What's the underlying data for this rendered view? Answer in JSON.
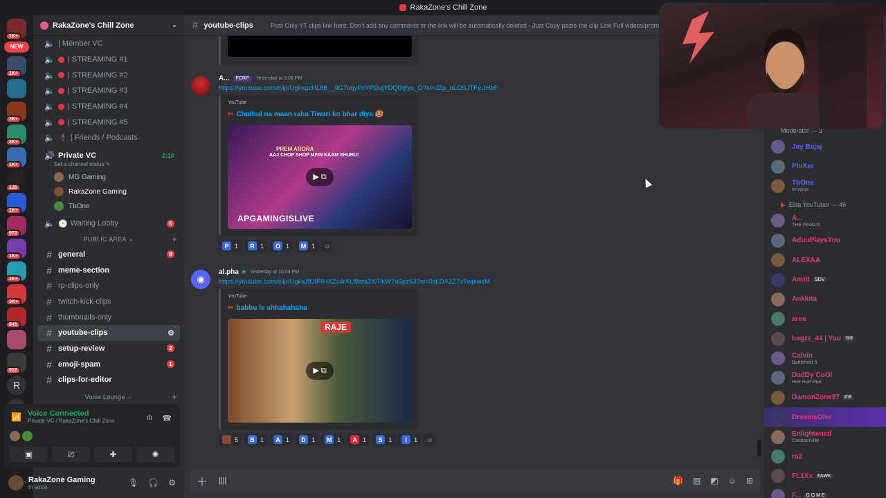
{
  "window": {
    "title": "RakaZone's Chill Zone"
  },
  "server_rail": [
    {
      "badge": "1K+"
    },
    {
      "badge": "NEW"
    },
    {
      "badge": "1K+"
    },
    {
      "badge": ""
    },
    {
      "badge": "3K+"
    },
    {
      "badge": "2K+"
    },
    {
      "badge": "1K+"
    },
    {
      "badge": "135"
    },
    {
      "badge": "1K+"
    },
    {
      "badge": "972"
    },
    {
      "badge": "1K+"
    },
    {
      "badge": "1K+"
    },
    {
      "badge": "3K+"
    },
    {
      "badge": "845"
    },
    {
      "badge": ""
    },
    {
      "badge": "512"
    }
  ],
  "server_rail_r": "R",
  "server": {
    "name": "RakaZone's Chill Zone"
  },
  "voice_channels": [
    {
      "label": "| Member VC",
      "icon": "speaker-icon"
    },
    {
      "label": "| STREAMING #1"
    },
    {
      "label": "| STREAMING #2"
    },
    {
      "label": "| STREAMING #3"
    },
    {
      "label": "| STREAMING #4"
    },
    {
      "label": "| STREAMING #5"
    },
    {
      "label": "| Friends / Podcasts"
    }
  ],
  "private_vc": {
    "label": "Private VC",
    "time": "2:10",
    "status": "Set a channel status"
  },
  "voice_users": [
    {
      "name": "MG Gaming",
      "color": "#8a6a4a"
    },
    {
      "name": "RakaZone Gaming",
      "color": "#7a5030"
    },
    {
      "name": "TbOne",
      "color": "#4a8a3a"
    }
  ],
  "waiting_lobby": {
    "label": "Waiting Lobby",
    "badge": "6"
  },
  "public_area": "PUBLIC AREA",
  "text_channels": [
    {
      "label": "general",
      "badge": "8",
      "bright": true
    },
    {
      "label": "meme-section",
      "badge": "",
      "bright": true
    },
    {
      "label": "rp-clips-only",
      "badge": "",
      "bright": false
    },
    {
      "label": "twitch-kick-clips",
      "badge": "",
      "bright": false
    },
    {
      "label": "thumbnails-only",
      "badge": "",
      "bright": false
    },
    {
      "label": "youtube-clips",
      "badge": "",
      "bright": true,
      "active": true
    },
    {
      "label": "setup-review",
      "badge": "2",
      "bright": true
    },
    {
      "label": "emoji-spam",
      "badge": "1",
      "bright": true
    },
    {
      "label": "clips-for-editor",
      "badge": "",
      "bright": true
    }
  ],
  "voice_lounge": "Voice Lounge",
  "voice_panel": {
    "title": "Voice Connected",
    "subtitle": "Private VC / RakaZone's Chill Zone"
  },
  "user": {
    "name": "RakaZone Gaming",
    "status": "In voice"
  },
  "channel": {
    "name": "youtube-clips",
    "topic": "Post Only YT clips link here. Don't add any comments or the link will be automatically deleted - Just Copy paste the clip Link Full videos/promot"
  },
  "messages": [
    {
      "author": "A...",
      "tag": "FCRP",
      "timestamp": "Yesterday at 9:06 PM",
      "link": "https://youtube.com/clip/UgkxgcHL88__9G7utjyPcYPDujYDQ0qfyo_O?si=JZp_oLOSJTFy.JHbF",
      "embed": {
        "provider": "YouTube",
        "title": "Chulbul na maan raha Tiwari ko bhar diya 🥵"
      },
      "thumb_lines": [
        "PREM ARORA",
        "AAJ CHOP SHOP MEIN KAAM SHURU!",
        "APGAMINGISLIVE"
      ],
      "reactions": [
        {
          "letter": "P",
          "count": "1"
        },
        {
          "letter": "R",
          "count": "1"
        },
        {
          "letter": "O",
          "count": "1"
        },
        {
          "letter": "M",
          "count": "1"
        }
      ]
    },
    {
      "author": "al.pha",
      "tag": "",
      "timestamp": "Yesterday at 10:44 PM",
      "link": "https://youtube.com/clip/UgkxJfU8RHXZc4rALf8sfa2I07lkW7a5pz53?si=0xLDA2Z7vTwplwcM",
      "embed": {
        "provider": "YouTube",
        "title": "babbu le ahhahahaha"
      },
      "thumb_lines": [
        "RAJE"
      ],
      "reactions": [
        {
          "letter": "",
          "count": "5",
          "img": true
        },
        {
          "letter": "B",
          "count": "1"
        },
        {
          "letter": "A",
          "count": "1"
        },
        {
          "letter": "D",
          "count": "1"
        },
        {
          "letter": "M",
          "count": "1"
        },
        {
          "letter": "A",
          "count": "1",
          "red": true
        },
        {
          "letter": "S",
          "count": "1"
        },
        {
          "letter": "I",
          "count": "1"
        }
      ]
    }
  ],
  "composer": {
    "text": "||||"
  },
  "members": {
    "moderator_group": "Moderator — 3",
    "moderators": [
      {
        "name": "Jay Bajaj",
        "color": "#5865f2",
        "activity": ""
      },
      {
        "name": "PhiXer",
        "color": "#5865f2",
        "activity": ""
      },
      {
        "name": "TbOne",
        "color": "#5865f2",
        "activity": "In voice"
      }
    ],
    "elite_group": "Elite YouTuber — 46",
    "elite": [
      {
        "name": "A...",
        "color": "#e23a7a",
        "activity": "THE FINALS"
      },
      {
        "name": "AduuPlaysYou",
        "color": "#e23a7a",
        "activity": ""
      },
      {
        "name": "ALEXAA",
        "color": "#e23a7a",
        "activity": ""
      },
      {
        "name": "Amrit",
        "color": "#e23a7a",
        "activity": "",
        "pill": "SDV"
      },
      {
        "name": "Ankkita",
        "color": "#e23a7a",
        "activity": ""
      },
      {
        "name": "area",
        "color": "#e23a7a",
        "activity": ""
      },
      {
        "name": "bagzz_44 | Yuu",
        "color": "#e23a7a",
        "activity": "",
        "pill": "राज"
      },
      {
        "name": "Calvin",
        "color": "#e23a7a",
        "activity": "Battlefield 6"
      },
      {
        "name": "DadDy CoOl",
        "color": "#e23a7a",
        "activity": "Hue Hue Hue"
      },
      {
        "name": "DamonZone97",
        "color": "#e23a7a",
        "activity": "",
        "pill": "राज"
      },
      {
        "name": "DreamsOfer",
        "color": "#e23a7a",
        "activity": "",
        "highlight": true
      },
      {
        "name": "Enlightened",
        "color": "#e23a7a",
        "activity": "ContractVille"
      },
      {
        "name": "ra2",
        "color": "#e23a7a",
        "activity": ""
      },
      {
        "name": "FL1Xx",
        "color": "#e23a7a",
        "activity": "",
        "pill": "FAWK"
      },
      {
        "name": "F...",
        "color": "#e23a7a",
        "activity": "",
        "pill": "G G M E"
      }
    ]
  },
  "colors": {
    "accent": "#5865f2",
    "link": "#00a8fc",
    "online": "#23a55a",
    "mention": "#f23f43"
  }
}
